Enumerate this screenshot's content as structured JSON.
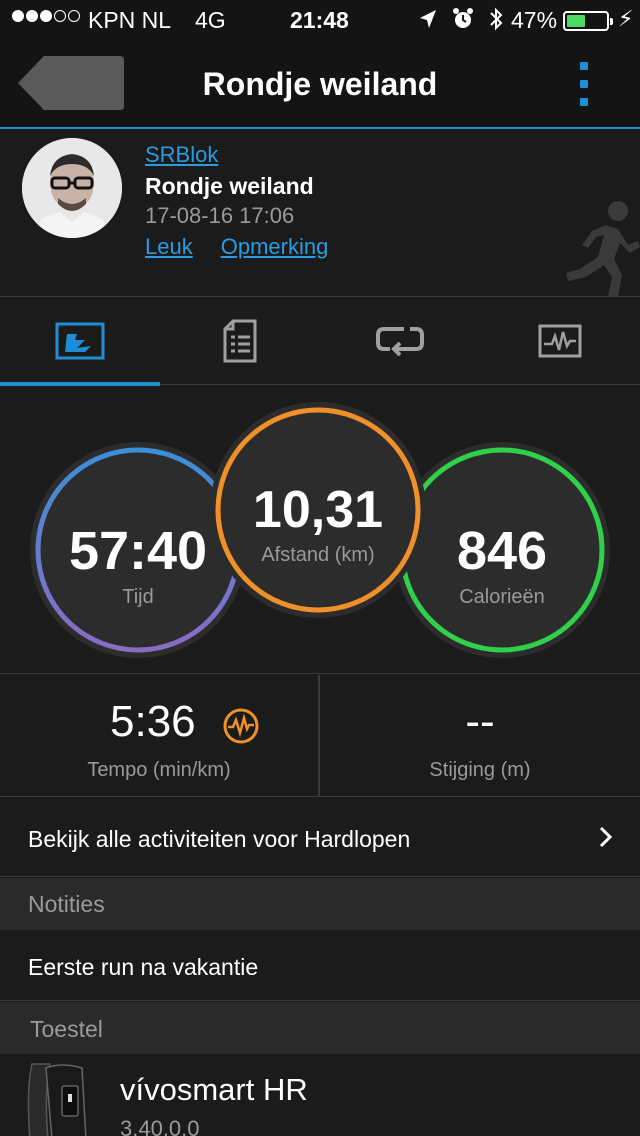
{
  "status_bar": {
    "carrier": "KPN NL",
    "network": "4G",
    "time": "21:48",
    "battery_percent": "47%",
    "battery_level": 0.47,
    "signal_bars_filled": 3,
    "signal_bars_total": 5
  },
  "nav": {
    "title": "Rondje weiland",
    "accent_color": "#1e8fd6"
  },
  "activity": {
    "user": "SRBlok",
    "name": "Rondje weiland",
    "datetime": "17-08-16 17:06",
    "like_label": "Leuk",
    "comment_label": "Opmerking",
    "type_icon": "runner-icon"
  },
  "tabs": [
    {
      "icon": "overview-icon",
      "active": true
    },
    {
      "icon": "details-icon",
      "active": false
    },
    {
      "icon": "laps-icon",
      "active": false
    },
    {
      "icon": "chart-icon",
      "active": false
    }
  ],
  "metrics": {
    "time": {
      "value": "57:40",
      "label": "Tijd"
    },
    "distance": {
      "value": "10,31",
      "label": "Afstand (km)"
    },
    "calories": {
      "value": "846",
      "label": "Calorieën"
    },
    "pace": {
      "value": "5:36",
      "label": "Tempo (min/km)",
      "icon": "pace-wave-icon"
    },
    "elevation": {
      "value": "--",
      "label": "Stijging (m)"
    }
  },
  "colors": {
    "time_ring_start": "#3a8fd8",
    "time_ring_end": "#8b6bc2",
    "distance_ring": "#f0902a",
    "calories_ring": "#2fd14a"
  },
  "all_activities_link": "Bekijk alle activiteiten voor Hardlopen",
  "notes": {
    "header": "Notities",
    "text": "Eerste run na vakantie"
  },
  "device": {
    "header": "Toestel",
    "name": "vívosmart HR",
    "version": "3.40.0.0"
  }
}
